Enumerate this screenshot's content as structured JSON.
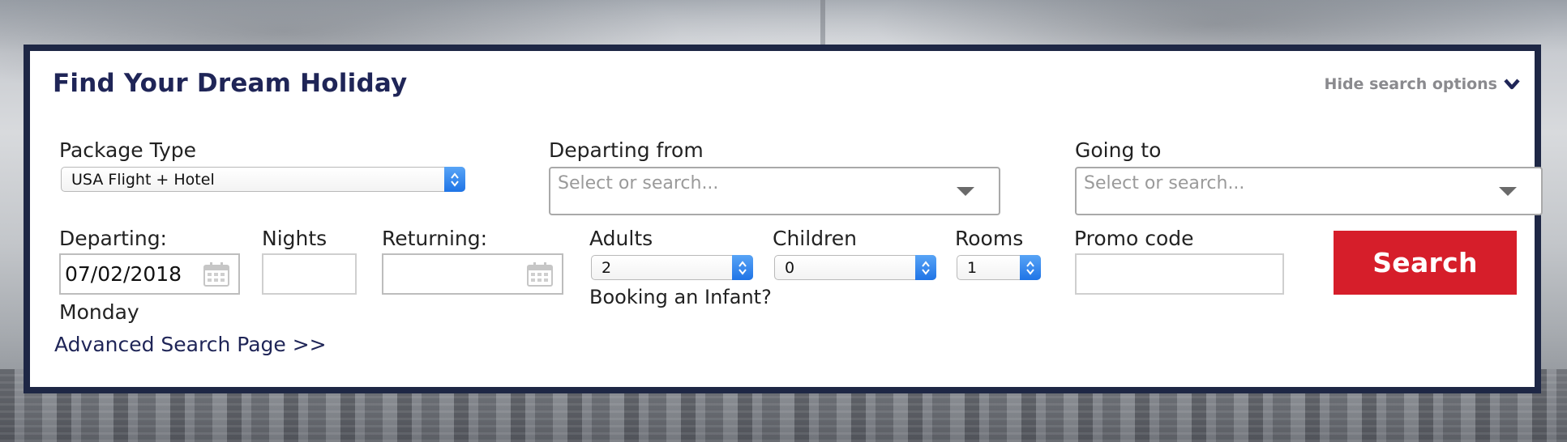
{
  "panel": {
    "title": "Find Your Dream Holiday",
    "toggle_label": "Hide search options"
  },
  "fields": {
    "package_type": {
      "label": "Package Type",
      "value": "USA Flight + Hotel"
    },
    "departing_from": {
      "label": "Departing from",
      "placeholder": "Select or search..."
    },
    "going_to": {
      "label": "Going to",
      "placeholder": "Select or search..."
    },
    "departing": {
      "label": "Departing:",
      "value": "07/02/2018",
      "weekday": "Monday"
    },
    "nights": {
      "label": "Nights",
      "value": ""
    },
    "returning": {
      "label": "Returning:",
      "value": ""
    },
    "adults": {
      "label": "Adults",
      "value": "2"
    },
    "children": {
      "label": "Children",
      "value": "0"
    },
    "rooms": {
      "label": "Rooms",
      "value": "1"
    },
    "infant_link": "Booking an Infant?",
    "promo": {
      "label": "Promo code",
      "value": ""
    }
  },
  "actions": {
    "search_label": "Search",
    "advanced_link": "Advanced Search Page >>"
  },
  "colors": {
    "panel_border": "#1e2745",
    "title": "#1f2557",
    "search_button": "#d61e2a",
    "select_stepper": "#1f74e6"
  },
  "icons": [
    "chevron-down-icon",
    "calendar-icon",
    "select-stepper-icon",
    "dropdown-caret-icon"
  ]
}
